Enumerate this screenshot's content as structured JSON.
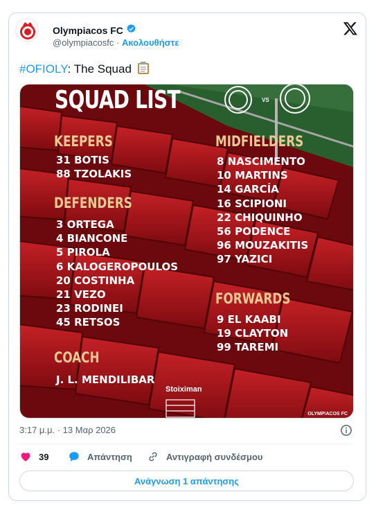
{
  "author": {
    "name": "Olympiacos FC",
    "handle": "@olympiacosfc",
    "separator": "·",
    "follow_label": "Ακολουθήστε"
  },
  "tweet": {
    "hashtag": "#OFIOLY",
    "text": ": The Squad",
    "emoji_icon": "clipboard-icon"
  },
  "media": {
    "title": "SQUAD LIST",
    "vs_label": "VS",
    "sections": {
      "keepers": {
        "label": "KEEPERS",
        "players": [
          "31 BOTIS",
          "88 TZOLAKIS"
        ]
      },
      "defenders": {
        "label": "DEFENDERS",
        "players": [
          "3 ORTEGA",
          "4 BIANCONE",
          "5 PIROLA",
          "6 KALOGEROPOULOS",
          "20 COSTINHA",
          "21 VEZO",
          "23 RODINEI",
          "45 RETSOS"
        ]
      },
      "coach": {
        "label": "COACH",
        "name": "J. L. MENDILIBAR"
      },
      "midfielders": {
        "label": "MIDFIELDERS",
        "players": [
          "8 NASCIMENTO",
          "10 MARTINS",
          "14 GARCÍA",
          "16 SCIPIONI",
          "22 CHIQUINHO",
          "56 PODENCE",
          "96 MOUZAKITIS",
          "97 YAZICI"
        ]
      },
      "forwards": {
        "label": "FORWARDS",
        "players": [
          "9 EL KAABI",
          "19 CLAYTON",
          "99 TAREMI"
        ]
      }
    },
    "sponsor": "Stoiximan",
    "watermark": "OLYMPIACOS FC"
  },
  "meta": {
    "timestamp": "3:17 μ.μ. · 13 Μαρ 2026"
  },
  "actions": {
    "like_count": "39",
    "reply_label": "Απάντηση",
    "copy_link_label": "Αντιγραφή συνδέσμου"
  },
  "read_replies_label": "Ανάγνωση 1 απάντησης",
  "colors": {
    "accent": "#1d9bf0",
    "like": "#f91880",
    "section_gold": "#e9c894",
    "seat_red": "#c8161e"
  }
}
